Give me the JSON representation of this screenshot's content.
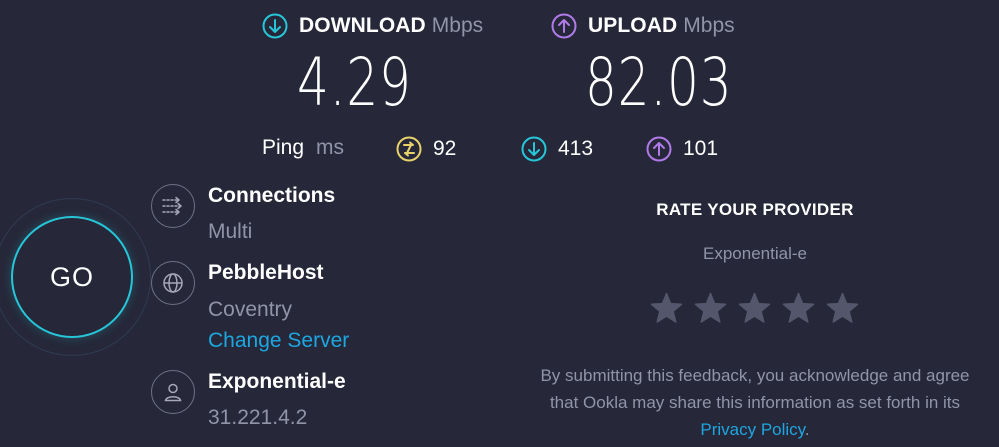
{
  "download": {
    "label": "DOWNLOAD",
    "unit": "Mbps",
    "value": "4.29",
    "icon": "arrow-down-circle-icon",
    "color": "#26c6d9"
  },
  "upload": {
    "label": "UPLOAD",
    "unit": "Mbps",
    "value": "82.03",
    "icon": "arrow-up-circle-icon",
    "color": "#b07ae8"
  },
  "ping": {
    "label": "Ping",
    "unit": "ms",
    "idle": "92",
    "download": "413",
    "upload": "101",
    "idle_color": "#e8d36b"
  },
  "go_button": {
    "label": "GO",
    "ring_color": "#26c6d9"
  },
  "connections": {
    "title": "Connections",
    "value": "Multi",
    "icon": "connections-arrows-icon"
  },
  "server": {
    "title": "PebbleHost",
    "location": "Coventry",
    "change_label": "Change Server",
    "icon": "globe-icon"
  },
  "provider": {
    "title": "Exponential-e",
    "ip": "31.221.4.2",
    "icon": "user-icon"
  },
  "rating": {
    "title": "RATE YOUR PROVIDER",
    "provider_name": "Exponential-e",
    "stars": 5,
    "filled": 0,
    "disclaimer_pre": "By submitting this feedback, you acknowledge and agree that Ookla may share this information as set forth in its ",
    "privacy_link": "Privacy Policy",
    "disclaimer_post": "."
  },
  "colors": {
    "background": "#262839",
    "muted": "#9193a8",
    "link": "#1da6e0",
    "star": "#54576b"
  }
}
